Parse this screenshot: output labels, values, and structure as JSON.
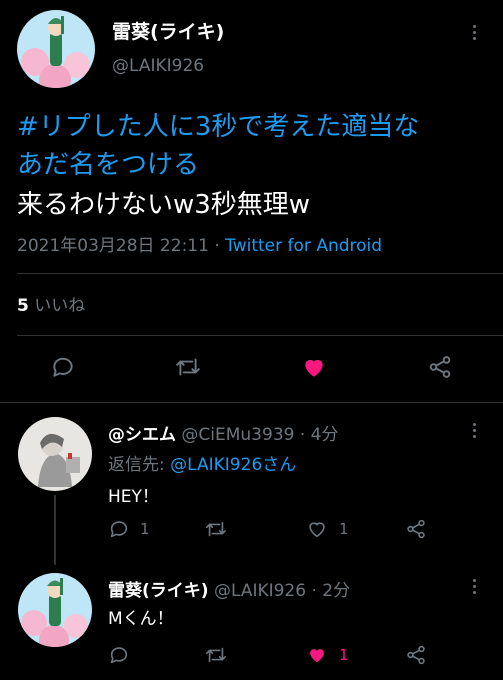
{
  "main_tweet": {
    "display_name": "雷葵(ライキ)",
    "handle": "@LAIKI926",
    "hashtag_line1": "#リプした人に3秒で考えた適当な",
    "hashtag_line2": "あだ名をつける",
    "body": "来るわけないw3秒無理w",
    "timestamp": "2021年03月28日 22:11",
    "separator": " · ",
    "client": "Twitter for Android",
    "likes_count": "5",
    "likes_label": "いいね"
  },
  "replies": [
    {
      "display_name": "@シエム",
      "handle": "@CiEMu3939",
      "time": "4分",
      "reply_to_prefix": "返信先: ",
      "reply_to_handle": "@LAIKI926さん",
      "text": "HEY！",
      "reply_count": "1",
      "retweet_count": "",
      "like_count": "1",
      "liked": false
    },
    {
      "display_name": "雷葵(ライキ)",
      "handle": "@LAIKI926",
      "time": "2分",
      "text": "Mくん！",
      "reply_count": "",
      "retweet_count": "",
      "like_count": "1",
      "liked": true
    }
  ],
  "colors": {
    "background": "#000000",
    "link": "#1d9bf0",
    "muted": "#6e767d",
    "like": "#f91880",
    "divider": "#2f3336"
  }
}
